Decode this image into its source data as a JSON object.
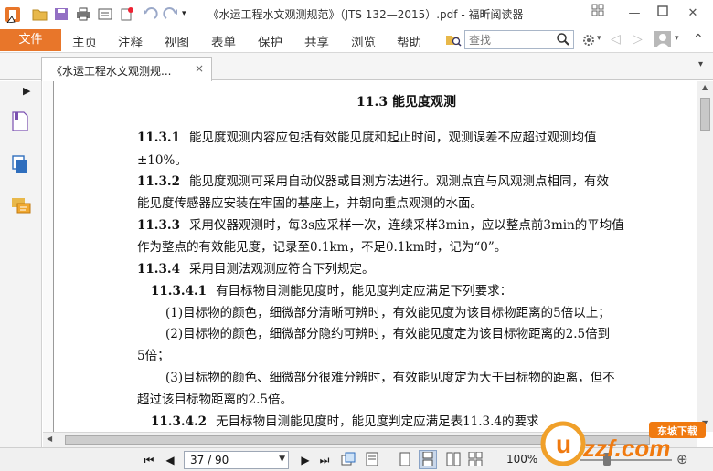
{
  "window": {
    "title": "《水运工程水文观测规范》（JTS 132—2015）.pdf - 福昕阅读器"
  },
  "menu": {
    "file": "文件",
    "items": [
      "主页",
      "注释",
      "视图",
      "表单",
      "保护",
      "共享",
      "浏览",
      "帮助"
    ],
    "search_placeholder": "查找"
  },
  "tab": {
    "label": "《水运工程水文观测规...",
    "close": "×"
  },
  "document": {
    "section_title": "11.3  能见度观测",
    "lines": [
      {
        "num": "11.3.1",
        "text": "能见度观测内容应包括有效能见度和起止时间，观测误差不应超过观测均值"
      },
      {
        "num": "",
        "text": "±10%。"
      },
      {
        "num": "11.3.2",
        "text": "能见度观测可采用自动仪器或目测方法进行。观测点宜与风观测点相同，有效"
      },
      {
        "num": "",
        "text": "能见度传感器应安装在牢固的基座上，并朝向重点观测的水面。"
      },
      {
        "num": "11.3.3",
        "text": "采用仪器观测时，每3s应采样一次，连续采样3min，应以整点前3min的平均值"
      },
      {
        "num": "",
        "text": "作为整点的有效能见度，记录至0.1km，不足0.1km时，记为“0”。"
      },
      {
        "num": "11.3.4",
        "text": "采用目测法观测应符合下列规定。"
      },
      {
        "num": "11.3.4.1",
        "text": "有目标物目测能见度时，能见度判定应满足下列要求："
      },
      {
        "num": "",
        "text": "(1)目标物的颜色，细微部分清晰可辨时，有效能见度为该目标物距离的5倍以上；"
      },
      {
        "num": "",
        "text": "(2)目标物的颜色，细微部分隐约可辨时，有效能见度定为该目标物距离的2.5倍到"
      },
      {
        "num": "",
        "text": "5倍；"
      },
      {
        "num": "",
        "text": "(3)目标物的颜色、细微部分很难分辨时，有效能见度定为大于目标物的距离，但不"
      },
      {
        "num": "",
        "text": "超过该目标物距离的2.5倍。"
      },
      {
        "num": "11.3.4.2",
        "text": "无目标物目测能见度时，能见度判定应满足表11.3.4的要求"
      }
    ]
  },
  "status": {
    "page": "37 / 90",
    "zoom": "100%"
  },
  "watermark": {
    "text": "uzzf.com",
    "tag": "东坡下载"
  },
  "colors": {
    "accent": "#e8762a",
    "bg": "#f0f0f0"
  }
}
